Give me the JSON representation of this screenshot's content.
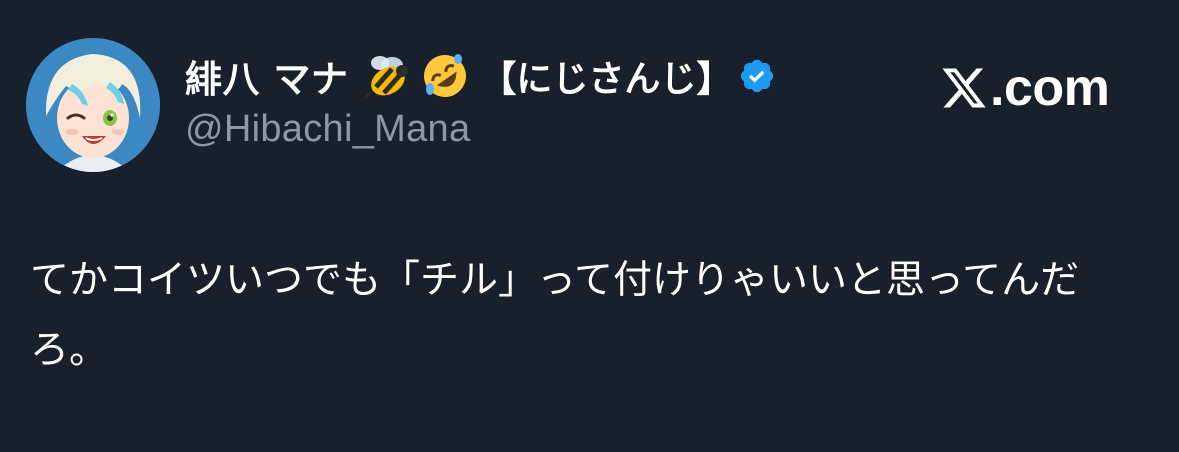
{
  "author": {
    "display_name": "緋八 マナ",
    "emoji_1": "honeybee",
    "emoji_2": "rolling-on-the-floor-laughing",
    "affiliation": "【にじさんじ】",
    "verified": true,
    "handle": "@Hibachi_Mana"
  },
  "brand": {
    "logo": "x-logo",
    "domain": ".com"
  },
  "tweet": {
    "text": "てかコイツいつでも「チル」って付けりゃいいと思ってんだろ。"
  },
  "colors": {
    "background": "#17202b",
    "text": "#ffffff",
    "handle": "#8b98a5",
    "verified_badge": "#1d9bf0"
  }
}
